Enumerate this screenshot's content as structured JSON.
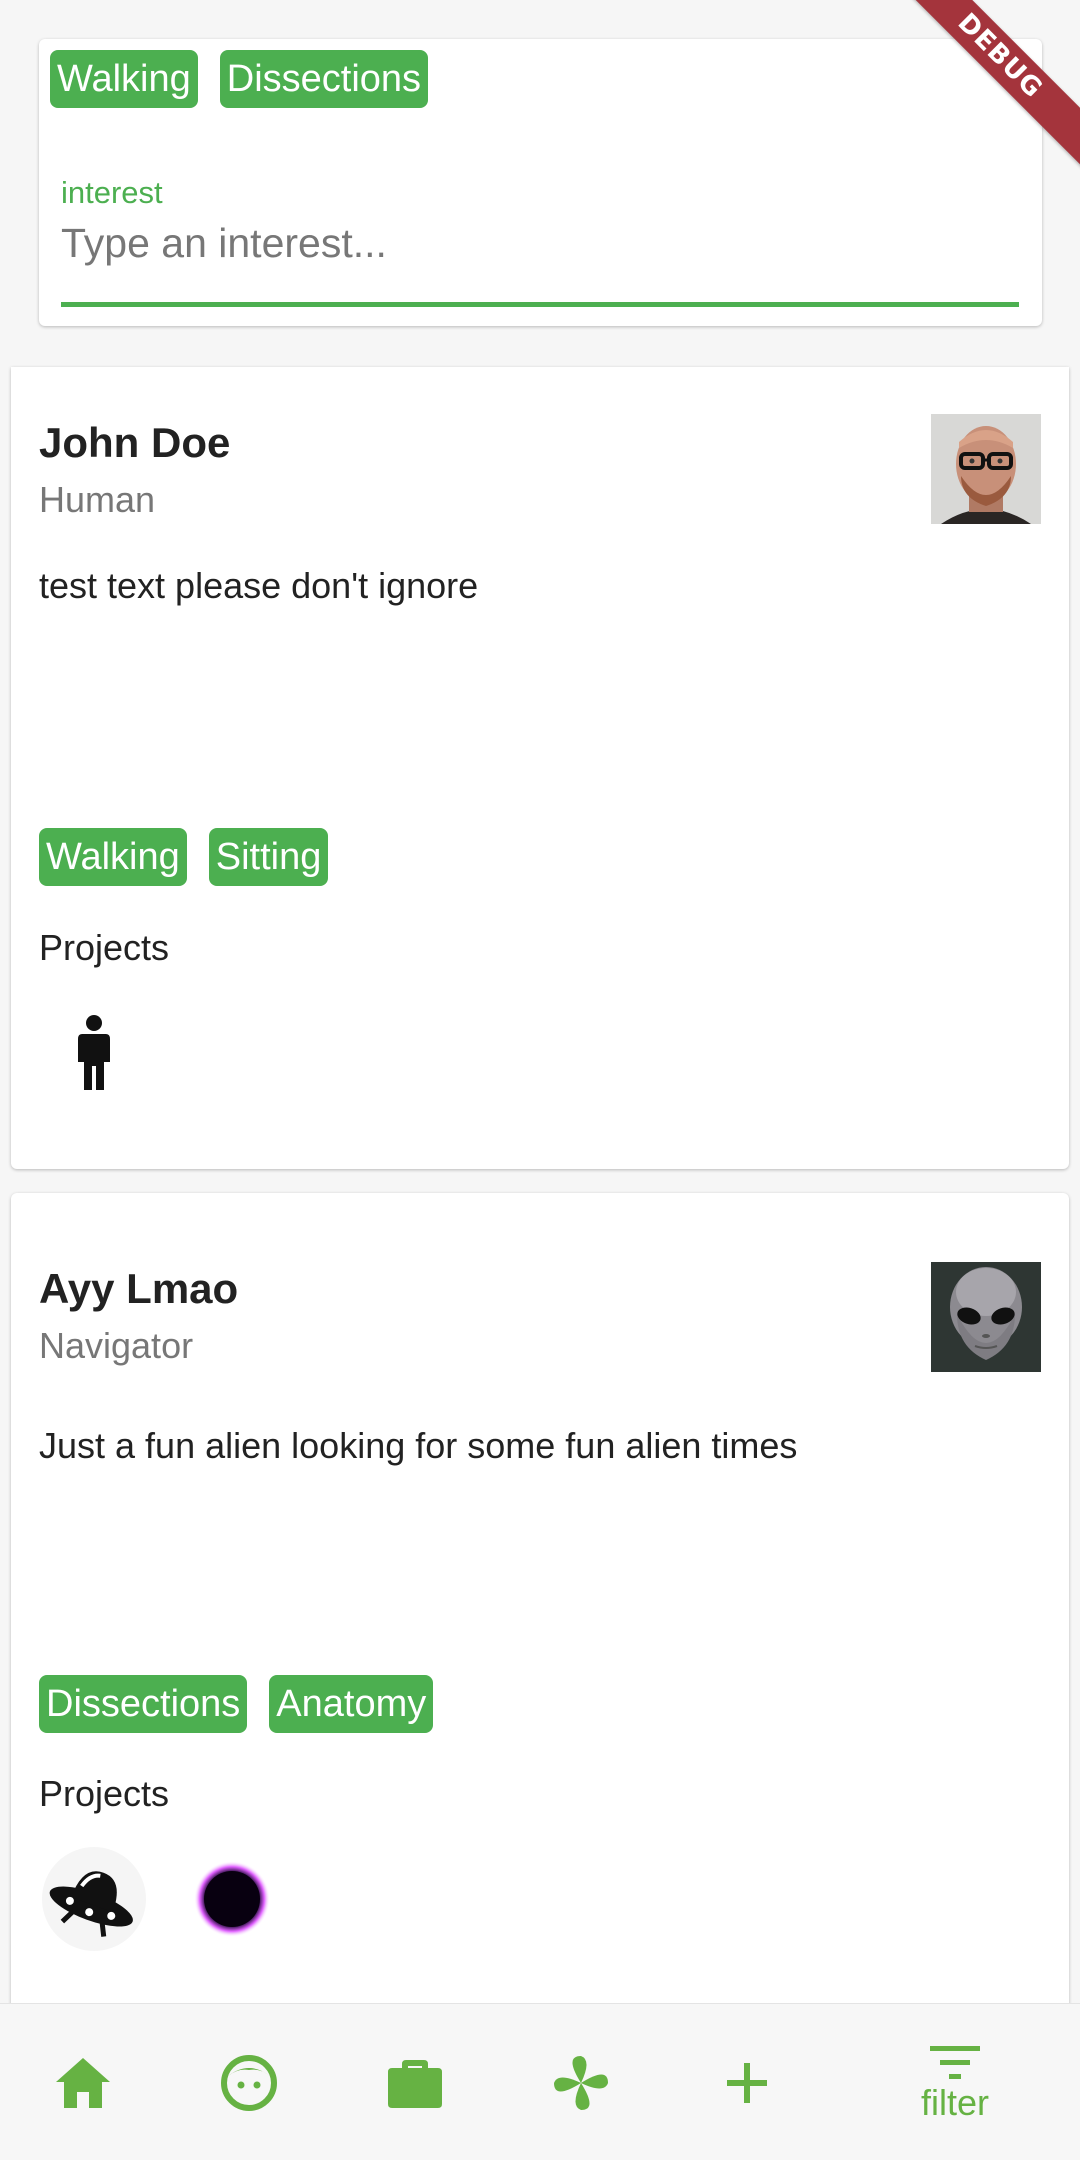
{
  "debug_banner": "DEBUG",
  "filter": {
    "chips": [
      "Walking",
      "Dissections"
    ],
    "field_label": "interest",
    "placeholder": "Type an interest...",
    "value": ""
  },
  "profiles": [
    {
      "name": "John Doe",
      "role": "Human",
      "bio": "test text please don't ignore",
      "interests": [
        "Walking",
        "Sitting"
      ],
      "projects_label": "Projects",
      "projects": [
        "person-icon"
      ]
    },
    {
      "name": "Ayy Lmao",
      "role": "Navigator",
      "bio": "Just a fun alien looking for some fun alien times",
      "interests": [
        "Dissections",
        "Anatomy"
      ],
      "projects_label": "Projects",
      "projects": [
        "ufo-icon",
        "black-hole-icon"
      ]
    }
  ],
  "nav": {
    "items": [
      {
        "icon": "home-icon"
      },
      {
        "icon": "face-icon"
      },
      {
        "icon": "briefcase-icon"
      },
      {
        "icon": "pinwheel-icon"
      },
      {
        "icon": "plus-icon"
      },
      {
        "icon": "filter-icon",
        "label": "filter"
      }
    ]
  },
  "colors": {
    "accent": "#4caf50",
    "nav_accent": "#66b243",
    "debug": "#a4343c"
  }
}
